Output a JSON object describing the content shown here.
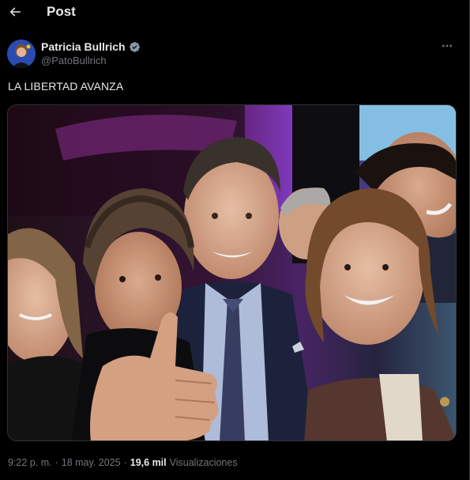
{
  "header": {
    "title": "Post",
    "back_icon": "arrow-left-icon"
  },
  "author": {
    "name": "Patricia Bullrich",
    "handle": "@PatoBullrich",
    "verified": true,
    "verified_color": "#8b98a5",
    "more_icon": "more-horizontal-icon"
  },
  "post": {
    "text": "LA LIBERTAD AVANZA"
  },
  "meta": {
    "time": "9:22 p. m.",
    "separator": "·",
    "date": "18 may. 2025",
    "views_count": "19,6 mil",
    "views_label": "Visualizaciones"
  },
  "colors": {
    "background": "#000000",
    "text_primary": "#e7e9ea",
    "text_secondary": "#71767b",
    "border": "#2f3336"
  }
}
